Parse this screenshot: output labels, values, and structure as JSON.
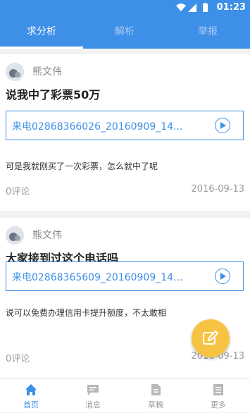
{
  "statusbar": {
    "time": "01:23"
  },
  "tabs": [
    {
      "label": "求分析"
    },
    {
      "label": "解析"
    },
    {
      "label": "举报"
    }
  ],
  "posts": [
    {
      "author": "熊文伟",
      "title": "说我中了彩票50万",
      "audio_file": "来电02868366026_20160909_14...",
      "body": "可是我就刚买了一次彩票，怎么就中了呢",
      "comments": "0评论",
      "date": "2016-09-13"
    },
    {
      "author": "熊文伟",
      "title": "大家接到过这个电话吗",
      "audio_file": "来电02868365609_20160909_14...",
      "body": "说可以免费办理信用卡提升额度，不太敢相",
      "comments": "0评论",
      "date": "2016-09-13"
    }
  ],
  "bottom_nav": [
    {
      "label": "首页",
      "icon": "home-icon"
    },
    {
      "label": "消息",
      "icon": "message-icon"
    },
    {
      "label": "草稿",
      "icon": "draft-icon"
    },
    {
      "label": "更多",
      "icon": "more-icon"
    }
  ],
  "colors": {
    "primary": "#3d8fe8",
    "fab": "#f6c343"
  }
}
